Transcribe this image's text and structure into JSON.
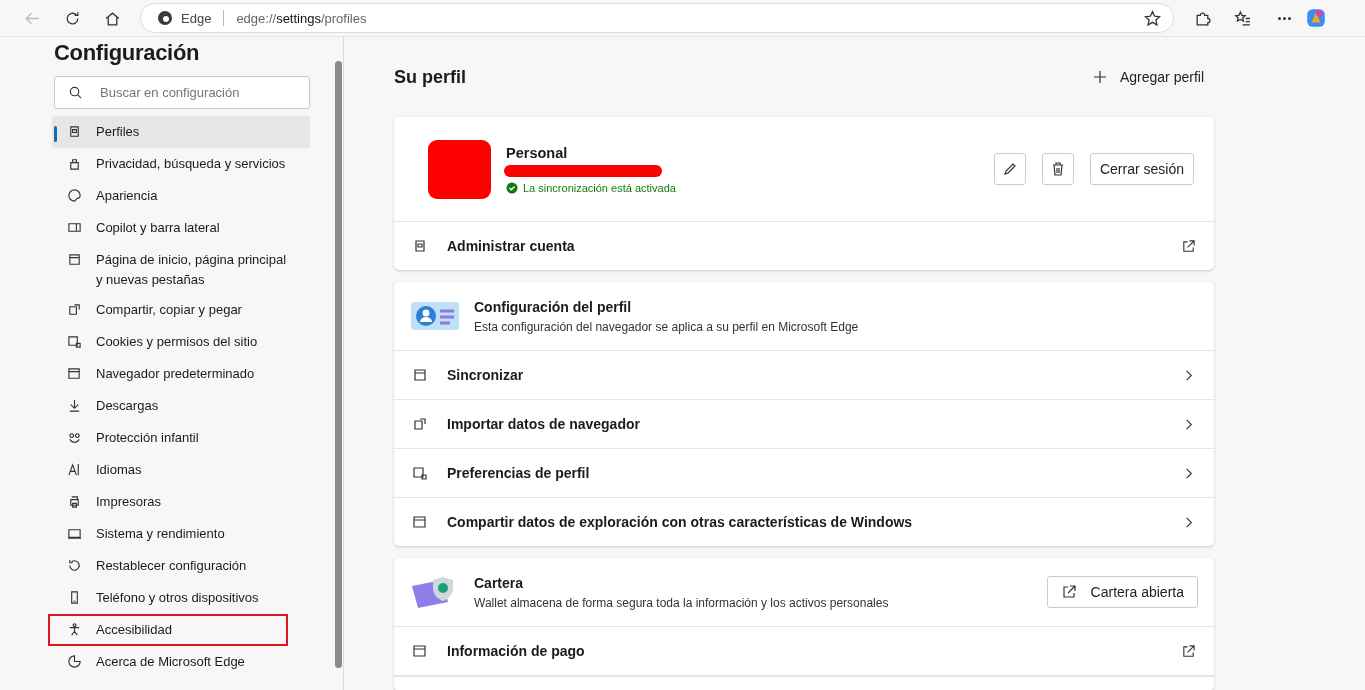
{
  "toolbar": {
    "site_label": "Edge",
    "url": {
      "scheme": "edge://",
      "host": "settings",
      "path": "/profiles"
    }
  },
  "sidebar": {
    "title": "Configuración",
    "search": {
      "placeholder": "Buscar en configuración"
    },
    "items": [
      {
        "label": "Perfiles",
        "selected": true,
        "highlighted": false
      },
      {
        "label": "Privacidad, búsqueda y servicios",
        "selected": false,
        "highlighted": false
      },
      {
        "label": "Apariencia",
        "selected": false,
        "highlighted": false
      },
      {
        "label": "Copilot y barra lateral",
        "selected": false,
        "highlighted": false
      },
      {
        "label": "Página de inicio, página principal y nuevas pestañas",
        "selected": false,
        "highlighted": false
      },
      {
        "label": "Compartir, copiar y pegar",
        "selected": false,
        "highlighted": false
      },
      {
        "label": "Cookies y permisos del sitio",
        "selected": false,
        "highlighted": false
      },
      {
        "label": "Navegador predeterminado",
        "selected": false,
        "highlighted": false
      },
      {
        "label": "Descargas",
        "selected": false,
        "highlighted": false
      },
      {
        "label": "Protección infantil",
        "selected": false,
        "highlighted": false
      },
      {
        "label": "Idiomas",
        "selected": false,
        "highlighted": false
      },
      {
        "label": "Impresoras",
        "selected": false,
        "highlighted": false
      },
      {
        "label": "Sistema y rendimiento",
        "selected": false,
        "highlighted": false
      },
      {
        "label": "Restablecer configuración",
        "selected": false,
        "highlighted": false
      },
      {
        "label": "Teléfono y otros dispositivos",
        "selected": false,
        "highlighted": false
      },
      {
        "label": "Accesibilidad",
        "selected": false,
        "highlighted": true
      },
      {
        "label": "Acerca de Microsoft Edge",
        "selected": false,
        "highlighted": false
      }
    ]
  },
  "main": {
    "title": "Su perfil",
    "add_profile": "Agregar perfil",
    "profile": {
      "name": "Personal",
      "sync_on": true,
      "sync_status": "La sincronización está activada",
      "sign_out": "Cerrar sesión"
    },
    "cards": [
      {
        "rows": [
          {
            "kind": "external",
            "label": "Administrar cuenta"
          }
        ]
      },
      {
        "rows": [
          {
            "kind": "header",
            "title": "Configuración del perfil",
            "subtitle": "Esta configuración del navegador se aplica a su perfil en Microsoft Edge"
          },
          {
            "kind": "nav",
            "label": "Sincronizar"
          },
          {
            "kind": "nav",
            "label": "Importar datos de navegador"
          },
          {
            "kind": "nav",
            "label": "Preferencias de perfil"
          },
          {
            "kind": "nav",
            "label": "Compartir datos de exploración con otras características de Windows"
          }
        ]
      },
      {
        "rows": [
          {
            "kind": "header",
            "title": "Cartera",
            "subtitle": "Wallet almacena de forma segura toda la información y los activos personales",
            "button": "Cartera abierta"
          },
          {
            "kind": "external",
            "label": "Información de pago"
          }
        ]
      }
    ]
  }
}
